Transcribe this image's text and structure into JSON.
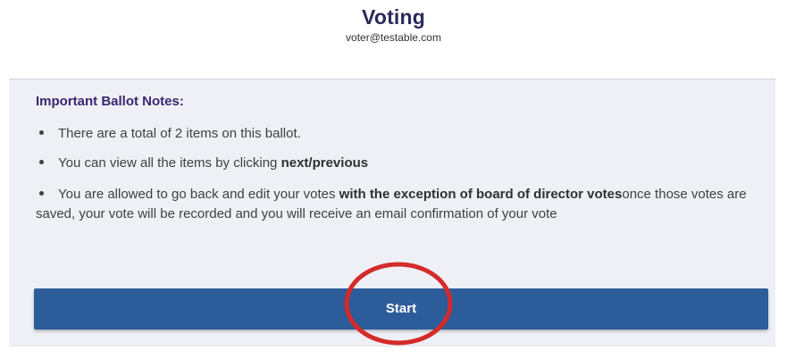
{
  "header": {
    "title": "Voting",
    "email": "voter@testable.com"
  },
  "notes": {
    "heading": "Important Ballot Notes:",
    "items": [
      {
        "text": "There are a total of 2 items on this ballot."
      },
      {
        "text": "You can view all the items by clicking ",
        "bold": "next/previous"
      },
      {
        "text": "You are allowed to go back and edit your votes ",
        "bold": "with the exception of board of director votes",
        "tail": "once those votes are saved, your vote will be recorded and you will receive an email confirmation of your vote"
      }
    ]
  },
  "actions": {
    "start_label": "Start"
  },
  "colors": {
    "title": "#2a2a5a",
    "heading": "#3a2670",
    "panel_background": "#eef0f5",
    "button": "#2d5c9a",
    "highlight": "#d42a2a"
  }
}
